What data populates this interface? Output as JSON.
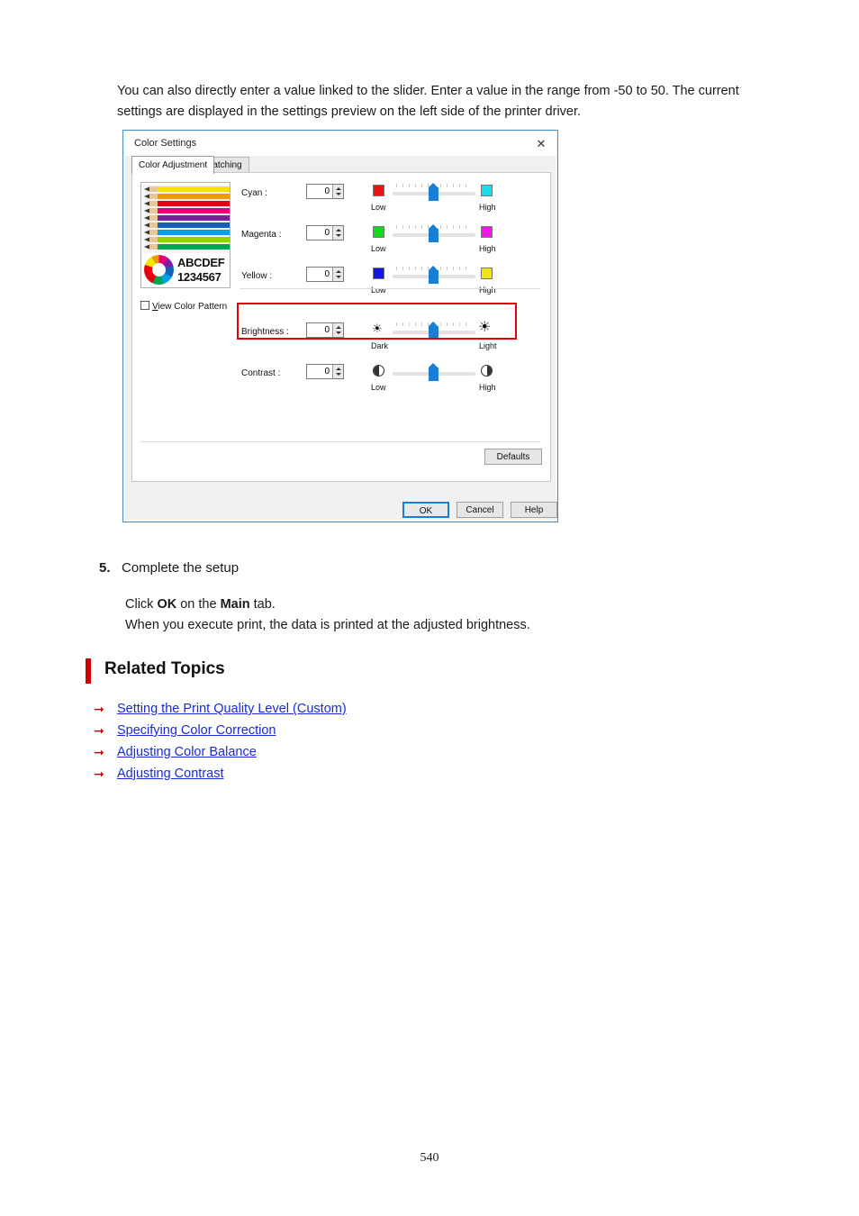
{
  "intro": {
    "paragraph": "You can also directly enter a value linked to the slider. Enter a value in the range from -50 to 50. The current settings are displayed in the settings preview on the left side of the printer driver."
  },
  "dialog": {
    "title": "Color Settings",
    "close_label": "✕",
    "tabs": [
      {
        "label": "Color Adjustment",
        "active": true
      },
      {
        "label": "Matching",
        "active": false
      }
    ],
    "preview": {
      "sample_text_line1": "ABCDEF",
      "sample_text_line2": "1234567",
      "pencil_colors": [
        "#f5e400",
        "#f39800",
        "#e60012",
        "#e2007a",
        "#7a1fa2",
        "#1560bd",
        "#00a0e9",
        "#8fd400",
        "#00a650"
      ]
    },
    "view_color_pattern": {
      "label_accel": "V",
      "label_rest": "iew Color Pattern",
      "checked": false
    },
    "rows": [
      {
        "label": "Cyan :",
        "accel": "C",
        "value": "0",
        "left_label": "Low",
        "right_label": "High",
        "left_swatch": "#ee1111",
        "right_swatch": "#19dded",
        "slider_percent": 50,
        "glyph_left": "swatch",
        "glyph_right": "swatch"
      },
      {
        "label": "Magenta :",
        "accel": "M",
        "value": "0",
        "left_label": "Low",
        "right_label": "High",
        "left_swatch": "#16d81e",
        "right_swatch": "#ee19e5",
        "slider_percent": 50,
        "glyph_left": "swatch",
        "glyph_right": "swatch"
      },
      {
        "label": "Yellow :",
        "accel": "Y",
        "value": "0",
        "left_label": "Low",
        "right_label": "High",
        "left_swatch": "#1515e0",
        "right_swatch": "#f2e313",
        "slider_percent": 50,
        "glyph_left": "swatch",
        "glyph_right": "swatch"
      },
      {
        "label": "Brightness :",
        "accel": "B",
        "value": "0",
        "left_label": "Dark",
        "right_label": "Light",
        "slider_percent": 50,
        "glyph_left": "sun-small-icon",
        "glyph_right": "sun-large-icon",
        "highlighted": true
      },
      {
        "label": "Contrast :",
        "accel": "n",
        "value": "0",
        "left_label": "Low",
        "right_label": "High",
        "slider_percent": 50,
        "glyph_left": "contrast-low-icon",
        "glyph_right": "contrast-high-icon"
      }
    ],
    "buttons": {
      "defaults": "Defaults",
      "ok": "OK",
      "cancel": "Cancel",
      "help": "Help"
    },
    "highlight_color": "#e60000"
  },
  "step": {
    "number": "5.",
    "heading": "Complete the setup",
    "body_line1_pre": "Click ",
    "body_line1_bold1": "OK",
    "body_line1_mid": " on the ",
    "body_line1_bold2": "Main",
    "body_line1_post": " tab.",
    "body_line2": "When you execute print, the data is printed at the adjusted brightness."
  },
  "related_topics": {
    "title": "Related Topics",
    "accent_color": "#cc0000",
    "links": [
      "Setting the Print Quality Level (Custom)",
      "Specifying Color Correction",
      "Adjusting Color Balance",
      "Adjusting Contrast"
    ]
  },
  "footer": {
    "page_number": "540"
  }
}
